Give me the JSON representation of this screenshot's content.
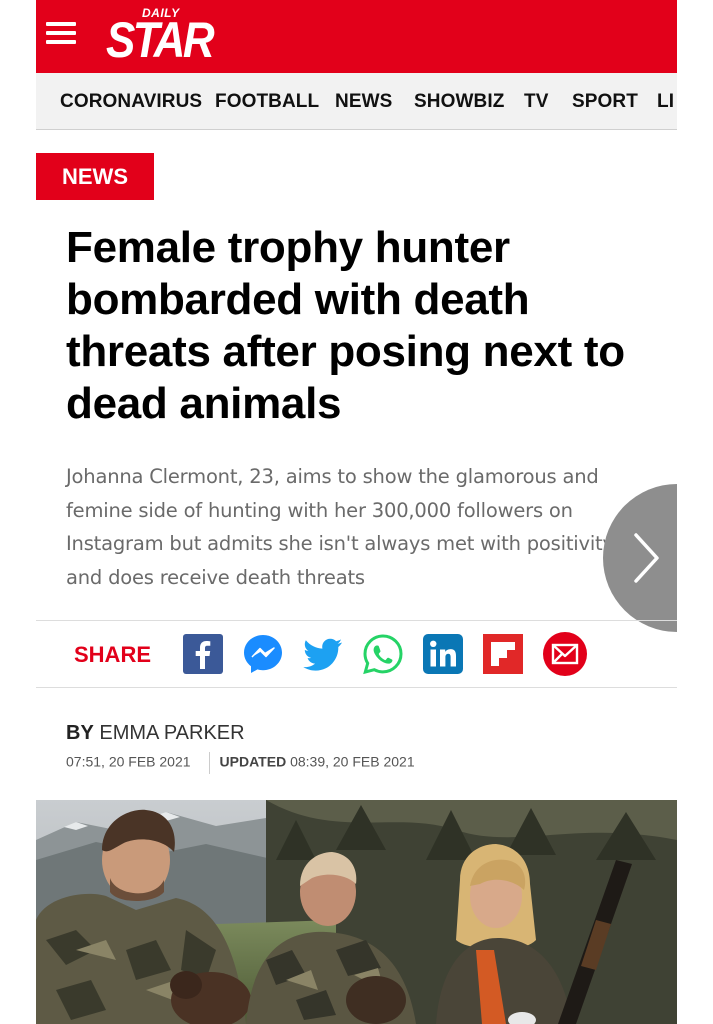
{
  "brand": {
    "logo_top": "DAILY",
    "logo_main": "STAR",
    "color_primary": "#e2001a"
  },
  "nav": {
    "items": [
      "CORONAVIRUS",
      "FOOTBALL",
      "NEWS",
      "SHOWBIZ",
      "TV",
      "SPORT",
      "LI"
    ]
  },
  "article": {
    "section_tag": "NEWS",
    "headline": "Female trophy hunter bombarded with death threats after posing next to dead animals",
    "standfirst": "Johanna Clermont, 23, aims to show the glamorous and femine side of hunting with her 300,000 followers on Instagram but admits she isn't always met with positivity and does receive death threats",
    "byline_prefix": "BY",
    "author": "EMMA PARKER",
    "published": "07:51, 20 FEB 2021",
    "updated_label": "UPDATED",
    "updated": "08:39, 20 FEB 2021"
  },
  "share": {
    "label": "SHARE",
    "icons": [
      "facebook-icon",
      "messenger-icon",
      "twitter-icon",
      "whatsapp-icon",
      "linkedin-icon",
      "flipboard-icon",
      "email-icon"
    ]
  }
}
